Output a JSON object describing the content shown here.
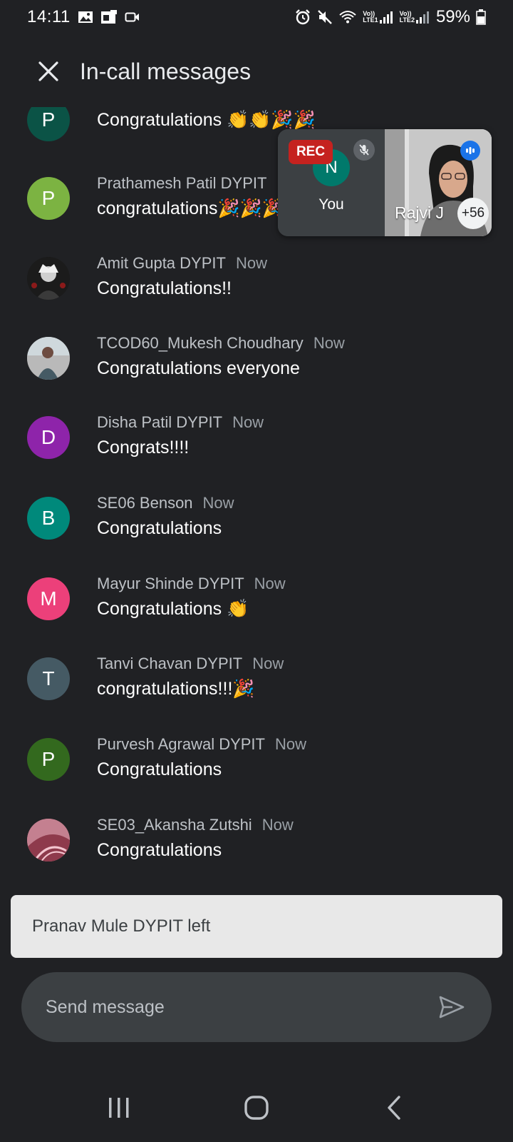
{
  "status_bar": {
    "time": "14:11",
    "battery": "59%",
    "lte1": "LTE1",
    "lte2": "LTE2",
    "volte": "Vo))"
  },
  "header": {
    "title": "In-call messages",
    "close_icon": "close-icon"
  },
  "video_tile": {
    "rec_label": "REC",
    "self_initial": "N",
    "self_label": "You",
    "remote_name": "Rajvi J",
    "more_count": "+56"
  },
  "messages": [
    {
      "initial": "P",
      "avatar_color": "#0b5346",
      "sender": "",
      "time": "",
      "text": "Congratulations 👏👏🎉🎉"
    },
    {
      "initial": "P",
      "avatar_color": "#7cb342",
      "sender": "Prathamesh Patil DYPIT",
      "time": "",
      "text": "congratulations🎉🎉🎉"
    },
    {
      "initial": "",
      "avatar_color": "#1b1b1b",
      "sender": "Amit Gupta DYPIT",
      "time": "Now",
      "text": "Congratulations!!"
    },
    {
      "initial": "",
      "avatar_color": "#8d8d8d",
      "sender": "TCOD60_Mukesh Choudhary",
      "time": "Now",
      "text": "Congratulations everyone"
    },
    {
      "initial": "D",
      "avatar_color": "#8e24aa",
      "sender": "Disha Patil DYPIT",
      "time": "Now",
      "text": "Congrats!!!!"
    },
    {
      "initial": "B",
      "avatar_color": "#00897b",
      "sender": "SE06 Benson",
      "time": "Now",
      "text": "Congratulations"
    },
    {
      "initial": "M",
      "avatar_color": "#ec407a",
      "sender": "Mayur Shinde DYPIT",
      "time": "Now",
      "text": "Congratulations 👏"
    },
    {
      "initial": "T",
      "avatar_color": "#455a64",
      "sender": "Tanvi Chavan DYPIT",
      "time": "Now",
      "text": "congratulations!!!🎉"
    },
    {
      "initial": "P",
      "avatar_color": "#33691e",
      "sender": "Purvesh Agrawal DYPIT",
      "time": "Now",
      "text": "Congratulations"
    },
    {
      "initial": "",
      "avatar_color": "#b05a6a",
      "sender": "SE03_Akansha Zutshi",
      "time": "Now",
      "text": "Congratulations"
    }
  ],
  "toast": {
    "text": "Pranav Mule DYPIT left"
  },
  "composer": {
    "placeholder": "Send message"
  }
}
